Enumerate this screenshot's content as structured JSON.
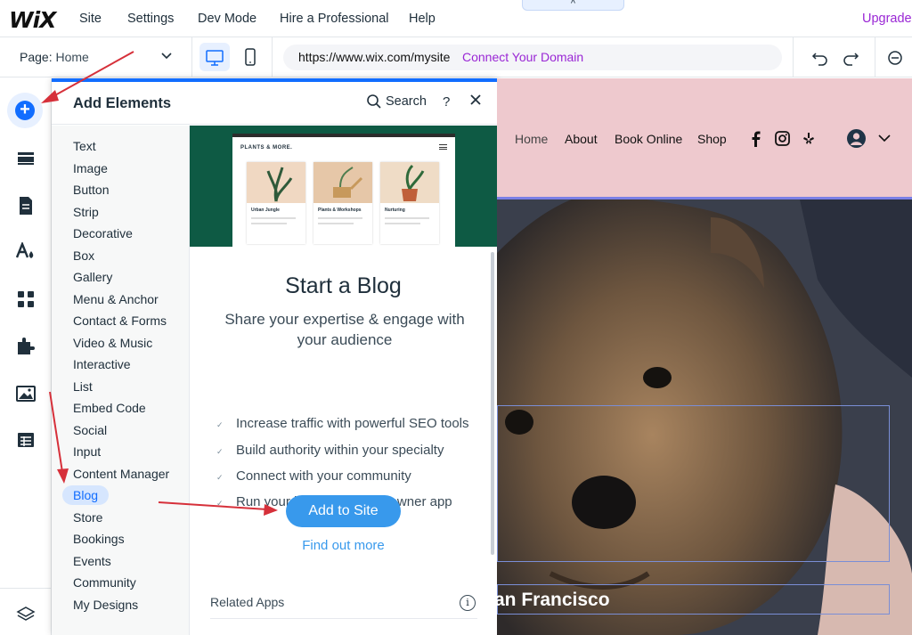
{
  "topbar": {
    "logo": "WiX",
    "menu": [
      "Site",
      "Settings",
      "Dev Mode",
      "Hire a Professional",
      "Help"
    ],
    "upgrade": "Upgrade",
    "collapse_tab": "^"
  },
  "toolbar": {
    "page_label": "Page:",
    "page_value": "Home",
    "url": "https://www.wix.com/mysite",
    "connect_domain": "Connect Your Domain"
  },
  "panel": {
    "title": "Add Elements",
    "search_label": "Search",
    "help": "?",
    "categories": [
      "Text",
      "Image",
      "Button",
      "Strip",
      "Decorative",
      "Box",
      "Gallery",
      "Menu & Anchor",
      "Contact & Forms",
      "Video & Music",
      "Interactive",
      "List",
      "Embed Code",
      "Social",
      "Input",
      "Content Manager",
      "Blog",
      "Store",
      "Bookings",
      "Events",
      "Community",
      "My Designs"
    ],
    "selected_category": "Blog",
    "preview": {
      "site_title": "PLANTS & MORE.",
      "cards": [
        "Urban Jungle",
        "Plants & Workshops",
        "Nurturing"
      ]
    },
    "blog_title": "Start a Blog",
    "blog_subtitle": "Share your expertise & engage with your audience",
    "features": [
      "Increase traffic with powerful SEO tools",
      "Build authority within your specialty",
      "Connect with your community",
      "Run your blog on the Wix owner app"
    ],
    "add_button": "Add to Site",
    "find_more": "Find out more",
    "related_apps": "Related Apps"
  },
  "site": {
    "nav": [
      "Home",
      "About",
      "Book Online",
      "Shop"
    ],
    "city_text": "an Francisco"
  },
  "colors": {
    "accent": "#116dff",
    "purple": "#9a27d5",
    "header_pink": "#eec9ce",
    "button_blue": "#3899ec",
    "arrow_red": "#d6303a"
  }
}
